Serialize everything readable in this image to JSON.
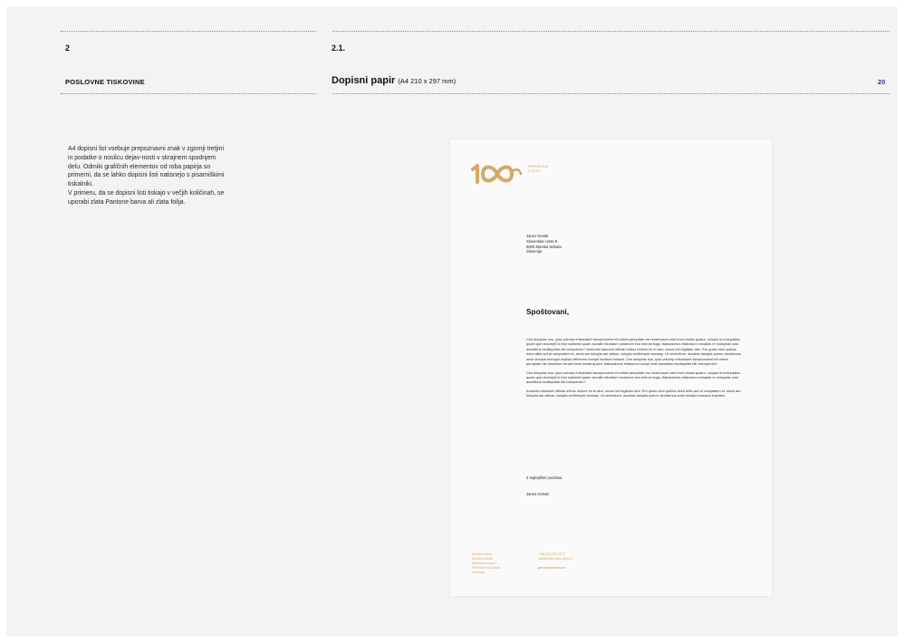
{
  "header": {
    "section_number": "2",
    "subsection_number": "2.1.",
    "section_title": "POSLOVNE TISKOVINE",
    "doc_title": "Dopisni papir",
    "doc_dims": "(A4 210 x 297 mm)",
    "page_number": "20"
  },
  "description": {
    "paragraph1": "A4 dopisni list vsebuje prepoznavni znak  v zgornji tretjini in podatke o nosilcu dejav-nosti v skrajnem spodnjem delu. Odmiki grafičnih elementov od roba papirja so primerni, da se lahko dopisni listi natisnejo s pisarniškimi tiskalniki.",
    "paragraph2": "V primeru, da se dopisni listi tiskajo v večjih količinah, se uporabi zlata Pantone barva ali zlata folija."
  },
  "letter": {
    "logo_text": "100",
    "logo_tagline_1": "PREKMURJE",
    "logo_tagline_2": "V DEČU",
    "recipient": [
      "Janez Novak",
      "Slovenska cesta 9",
      "9000 Murska Sobota",
      "Slovenija"
    ],
    "greeting": "Spoštovani,",
    "body": [
      "Ces doluptas nus, ipsa volorep eribusdant faceprorumet idi velest peruptate nis ressimusve ndel invel essita quatur, volupis id moluptatus quam que doloreptl id etur soleseid quam accullit ntiundae nonserum eos estrum fuga. Itatiossimus ellaborum voluptas re moluptae cust acestibus escitiquidia idit volorperum? Anduntio taturiorit officab oribus molore im et atur, occus init fugitatur abo. Em quias nam quibus dolut alitis aut ut voluptatem et, sincti am dolupta aut atibus, volupta veriberspie esciasp. Ut venectiore, accatas dolupta sperro dendamus solor sinulpa eumque explias officerem earupti iscidunt eossint. Ces doluptas nus, ipsa volorep eribusdant faceprorumet idi velest peruptate nis ressimus vendel invel essita quatur. Itatiossimus ellaborum volupt cust acestibus escitiquidia idit volorperum?",
      "Ces doluptas nus, ipsa volorep eribusdant faceprorumet idi velest peruptate nis ressimusve ndel invel essita quatur, volupis id moluptatus quam que doloreptl id etur soleseid quam accullit ntiundae nonserum eos estrum fuga. Itatiossimus ellaborum voluptas re moluptae cust acestibus escitiquidia idit volorperum?",
      "Anduntio taturiorit officab oribus molore im et atur, occus init fugitatur abo. Em quias nam quibus dolut alitis aut ut voluptatem et, sincti am dolupta aut atibus, volupta veriberspie esciasp. Ut venectiore, accatas dolupta sperro dendamus solor sinulpa eumque expliaeo."
    ],
    "closing": "Z najlepšimi pozdravi,",
    "signer": "Janez Horvat",
    "footer_left": [
      "Mestna občina",
      "Murska Sobota",
      "Kardoševa ulica 2",
      "9000 Murska Sobota",
      "Slovenija"
    ],
    "footer_right": [
      "+386 (0)2 525 16 77",
      "info@prekmurjev-deco.si",
      "",
      "prekmurjevdeco.si"
    ]
  },
  "colors": {
    "gold": "#d5a868",
    "page_number_blue": "#2b3a8c",
    "board_background": "#f3f3f3"
  }
}
